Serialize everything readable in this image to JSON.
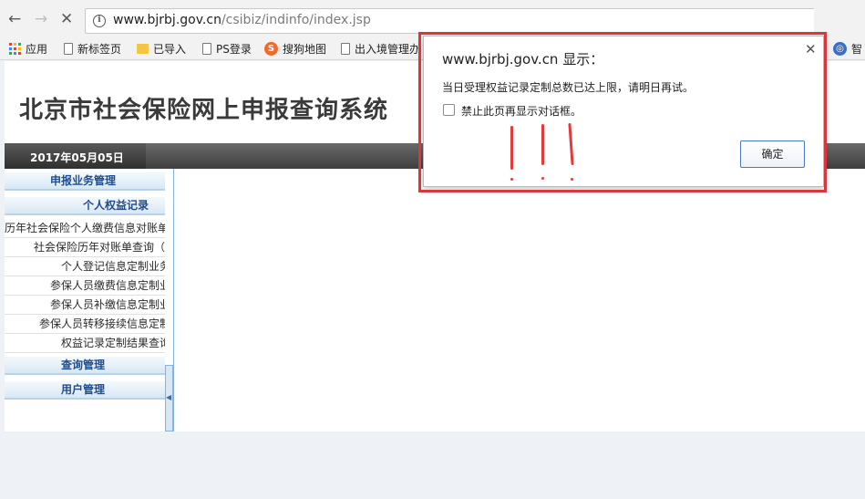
{
  "browser": {
    "url_host": "www.bjrbj.gov.cn",
    "url_path": "/csibiz/indinfo/index.jsp",
    "bookmarks": [
      "应用",
      "新标签页",
      "已导入",
      "PS登录",
      "搜狗地图",
      "出入境管理办",
      "智"
    ]
  },
  "site": {
    "title": "北京市社会保险网上申报查询系统",
    "date": "2017年05月05日"
  },
  "sidebar": {
    "sections": [
      "申报业务管理",
      "个人权益记录",
      "查询管理",
      "用户管理"
    ],
    "items": [
      "历年社会保险个人缴费信息对账单",
      "社会保险历年对账单查询（",
      "个人登记信息定制业务",
      "参保人员缴费信息定制业",
      "参保人员补缴信息定制业",
      "参保人员转移接续信息定制",
      "权益记录定制结果查询"
    ]
  },
  "dialog": {
    "title": "www.bjrbj.gov.cn 显示：",
    "message": "当日受理权益记录定制总数已达上限，请明日再试。",
    "checkbox_label": "禁止此页再显示对话框。",
    "ok_label": "确定"
  },
  "colors": {
    "highlight_border": "#d9373a",
    "sidebar_header_text": "#1f4d8f",
    "datebar": "#3f3f3f"
  }
}
